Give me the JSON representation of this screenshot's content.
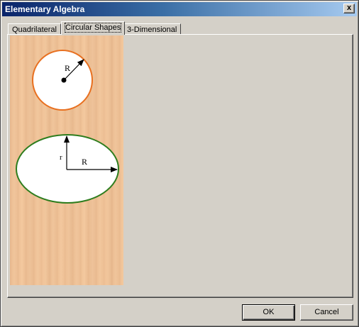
{
  "window": {
    "title": "Elementary Algebra",
    "close_label": "x"
  },
  "tabs": [
    {
      "label": "Quadrilateral",
      "selected": false
    },
    {
      "label": "Circular Shapes",
      "selected": true
    },
    {
      "label": "3-Dimensional",
      "selected": false
    }
  ],
  "diagram": {
    "circle": {
      "radius_label": "R",
      "stroke_color": "#e87020",
      "fill_color": "#ffffff"
    },
    "ellipse": {
      "major_label": "R",
      "minor_label": "r",
      "stroke_color": "#2e7d1e",
      "fill_color": "#ffffff"
    },
    "background": "wood-texture"
  },
  "buttons": {
    "ok_label": "OK",
    "cancel_label": "Cancel"
  }
}
